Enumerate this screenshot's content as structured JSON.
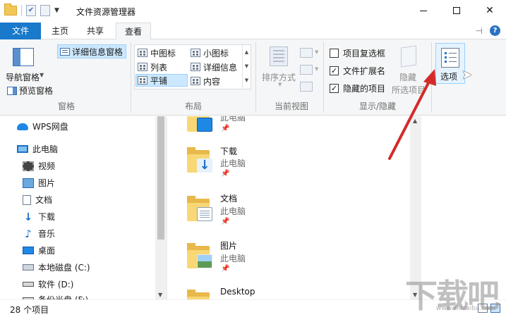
{
  "window": {
    "title": "文件资源管理器"
  },
  "tabs": {
    "file": "文件",
    "home": "主页",
    "share": "共享",
    "view": "查看"
  },
  "ribbon": {
    "pane_group": {
      "nav_pane": "导航窗格",
      "preview_pane": "预览窗格",
      "details_pane": "详细信息窗格",
      "label": "窗格"
    },
    "layout_group": {
      "items": [
        "中图标",
        "小图标",
        "列表",
        "详细信息",
        "平铺",
        "内容"
      ],
      "selected": "平铺",
      "label": "布局"
    },
    "current_view_group": {
      "sort_by": "排序方式",
      "label": "当前视图"
    },
    "show_hide_group": {
      "item_checkboxes": "项目复选框",
      "item_checkboxes_checked": false,
      "file_extensions": "文件扩展名",
      "file_extensions_checked": true,
      "hidden_items": "隐藏的项目",
      "hidden_items_checked": true,
      "hide_selected": "隐藏",
      "hide_selected_sub": "所选项目",
      "label": "显示/隐藏"
    },
    "options": "选项"
  },
  "nav": {
    "items": [
      {
        "label": "WPS网盘",
        "icon": "cloud-icon"
      },
      {
        "label": "此电脑",
        "icon": "computer-icon"
      },
      {
        "label": "视频",
        "icon": "video-icon"
      },
      {
        "label": "图片",
        "icon": "pictures-icon"
      },
      {
        "label": "文档",
        "icon": "documents-icon"
      },
      {
        "label": "下载",
        "icon": "download-icon"
      },
      {
        "label": "音乐",
        "icon": "music-icon"
      },
      {
        "label": "桌面",
        "icon": "desktop-icon"
      },
      {
        "label": "本地磁盘 (C:)",
        "icon": "disk-icon"
      },
      {
        "label": "软件 (D:)",
        "icon": "disk-icon"
      },
      {
        "label": "备份光盘 (F:)",
        "icon": "disk-icon"
      }
    ]
  },
  "content": {
    "items": [
      {
        "name": "",
        "sub": "此电脑"
      },
      {
        "name": "下载",
        "sub": "此电脑"
      },
      {
        "name": "文档",
        "sub": "此电脑"
      },
      {
        "name": "图片",
        "sub": "此电脑"
      },
      {
        "name": "Desktop",
        "sub": ""
      }
    ]
  },
  "status": {
    "count": "28 个项目"
  },
  "watermark": {
    "text": "下载吧",
    "sub": "www.xiazaiba.com"
  },
  "colors": {
    "accent": "#1979ca",
    "selection": "#cce8ff",
    "arrow": "#d42a2a"
  }
}
